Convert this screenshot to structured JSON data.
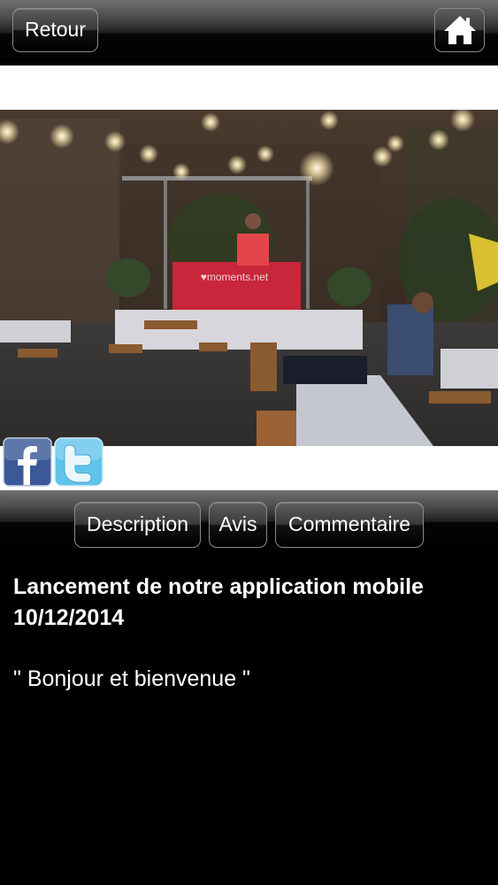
{
  "header": {
    "back_label": "Retour",
    "home_icon": "home-icon"
  },
  "photo": {
    "description_icon": "event-photo",
    "banner_text": "♥moments.net"
  },
  "social": {
    "facebook_icon": "facebook-icon",
    "twitter_icon": "twitter-icon",
    "facebook_color": "#3b5998",
    "twitter_color": "#5fc3ea"
  },
  "tabs": [
    {
      "label": "Description"
    },
    {
      "label": "Avis"
    },
    {
      "label": "Commentaire"
    }
  ],
  "content": {
    "title_line1": "Lancement de notre application mobile",
    "title_line2": "10/12/2014",
    "body": "\" Bonjour et bienvenue \""
  }
}
